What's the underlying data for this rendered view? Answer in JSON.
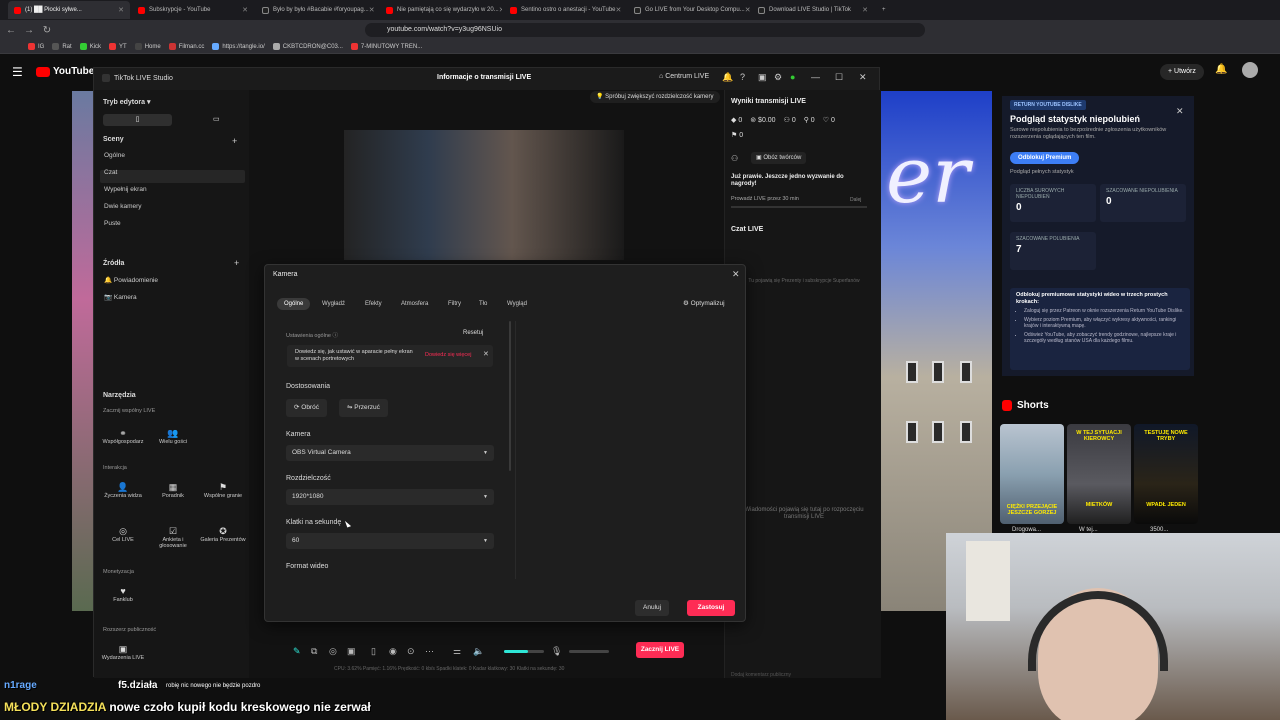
{
  "browser": {
    "tabs": [
      {
        "label": "(1) ██ Płocki sylwe...",
        "active": true
      },
      {
        "label": "Subskrypcje - YouTube"
      },
      {
        "label": "Było by było #Bacabie #foryoupag..."
      },
      {
        "label": "Nie pamiętają co się wydarzyło w 20..."
      },
      {
        "label": "Sentino ostro o anestacji - YouTube"
      },
      {
        "label": "Go LIVE from Your Desktop Compu..."
      },
      {
        "label": "Download LIVE Studio | TikTok"
      }
    ],
    "url": "youtube.com/watch?v=y3ug96NSUio",
    "bookmarks": [
      "IG",
      "Rat",
      "Kick",
      "YT",
      "Home",
      "Filman.cc",
      "https://tangle.io/",
      "CKBTCDRON@C03...",
      "7-MINUTOWY TREN..."
    ]
  },
  "youtube": {
    "logo": "YouTube",
    "create_label": "Utwórz",
    "rtd": {
      "badge": "RETURN YOUTUBE DISLIKE",
      "title": "Podgląd statystyk niepolubień",
      "desc": "Surowe niepolubienia to bezpośrednie zgłoszenia użytkowników rozszerzenia oglądających ten film.",
      "button": "Odblokuj Premium",
      "link": "Podgląd pełnych statystyk",
      "stats": [
        {
          "label": "LICZBA SUROWYCH NIEPOLUBIEŃ",
          "value": "0"
        },
        {
          "label": "SZACOWANE NIEPOLUBIENIA",
          "value": "0"
        },
        {
          "label": "SZACOWANE POLUBIENIA",
          "value": "7"
        }
      ],
      "promo_title": "Odblokuj premiumowe statystyki wideo w trzech prostych krokach:",
      "promo_steps": [
        "Zaloguj się przez Patreon w oknie rozszerzenia Return YouTube Dislike.",
        "Wybierz poziom Premium, aby włączyć wykresy aktywności, rankingi krajów i interaktywną mapę.",
        "Odśwież YouTube, aby zobaczyć trendy godzinowe, najlepsze kraje i szczegóły według stanów USA dla każdego filmu."
      ]
    },
    "shorts_title": "Shorts",
    "shorts": [
      {
        "cap": "CIĘŻKI PRZEJĄCIE JESZCZE GORZEJ",
        "title": "Drogowa..."
      },
      {
        "cap": "W TEJ SYTUACJI KIEROWCY",
        "capb": "MIETKÓW",
        "title": "W tej..."
      },
      {
        "cap": "TESTUJĘ NOWE TRYBY",
        "capb": "WPADŁ JEDEN",
        "title": "3500..."
      }
    ]
  },
  "tiktok": {
    "app_title": "TikTok LIVE Studio",
    "center_title": "Informacje o transmisji LIVE",
    "hub": "Centrum LIVE",
    "editor_mode": "Tryb edytora",
    "scenes_header": "Sceny",
    "scenes": [
      "Ogólne",
      "Czat",
      "Wypełnij ekran",
      "Dwie kamery",
      "Puste"
    ],
    "sources_header": "Źródła",
    "sources": [
      "Powiadomienie",
      "Kamera"
    ],
    "tools_header": "Narzędzia",
    "tools_sub1": "Zacznij wspólny LIVE",
    "tools_row1": [
      "Współgospodarz",
      "Wielu gości"
    ],
    "tools_sub2": "Interakcja",
    "tools_row2": [
      "Życzenia widza",
      "Poradnik",
      "Wspólne granie"
    ],
    "tools_row3": [
      "Cel LIVE",
      "Ankieta i głosowanie",
      "Galeria Prezentów"
    ],
    "tools_sub3": "Monetyzacja",
    "tools_row4": [
      "Fanklub"
    ],
    "tools_sub4": "Rozszerz publiczność",
    "tools_row5": [
      "Wydarzenia LIVE"
    ],
    "quality_hint": "Spróbuj zwiększyć rozdzielczość kamery",
    "results_title": "Wyniki transmisji LIVE",
    "stats": [
      "0",
      "$0.00",
      "0",
      "0",
      "0",
      "0"
    ],
    "creator_boost": "Obóz twórców",
    "challenge": "Już prawie. Jeszcze jedno wyzwanie do nagrody!",
    "challenge_task": "Prowadź LIVE przez 30 min",
    "challenge_done": "Dalej",
    "live_chat": "Czat LIVE",
    "chat_empty": "Tu pojawią się Prezenty i subskrypcje Superfanów",
    "msgs_empty": "Wiadomości pojawią się tutaj po rozpoczęciu transmisji LIVE",
    "chat_input": "Dodaj komentarz publiczny",
    "go_live": "Zacznij LIVE",
    "status_line": "CPU: 3.62%   Pamięć: 1.16%   Prędkość: 0 kb/s   Spadki klatek: 0   Kadar klatkowy: 30   Klatki na sekundę: 30"
  },
  "dialog": {
    "title": "Kamera",
    "tabs": [
      "Ogólne",
      "Wygładź",
      "Efekty",
      "Atmosfera",
      "Filtry",
      "Tło",
      "Wygląd"
    ],
    "optimize": "Optymalizuj",
    "section_general": "Ustawienia ogólne",
    "reset": "Resetuj",
    "tip_text": "Dowiedz się, jak ustawić w aparacie pełny ekran w scenach portretowych",
    "tip_link": "Dowiedz się więcej",
    "adjust_label": "Dostosowania",
    "rotate": "Obróć",
    "flip": "Przerzuć",
    "camera_label": "Kamera",
    "camera_value": "OBS Virtual Camera",
    "resolution_label": "Rozdzielczość",
    "resolution_value": "1920*1080",
    "fps_label": "Klatki na sekundę",
    "fps_value": "60",
    "format_label": "Format wideo",
    "cancel": "Anuluj",
    "apply": "Zastosuj"
  },
  "stream_overlay": {
    "user1": "n1rage",
    "user2": "f5.działa",
    "small_msg": "robię nic nowego nie będzie pozdro",
    "ticker_a": "MŁODY DZIADZIA",
    "ticker_b": "nowe czoło kupił",
    "ticker_c": "kodu kreskowego nie zerwał"
  },
  "colors": {
    "accent": "#fe2c55",
    "yt_red": "#ff0000",
    "rtd_blue": "#3d7ef5"
  }
}
